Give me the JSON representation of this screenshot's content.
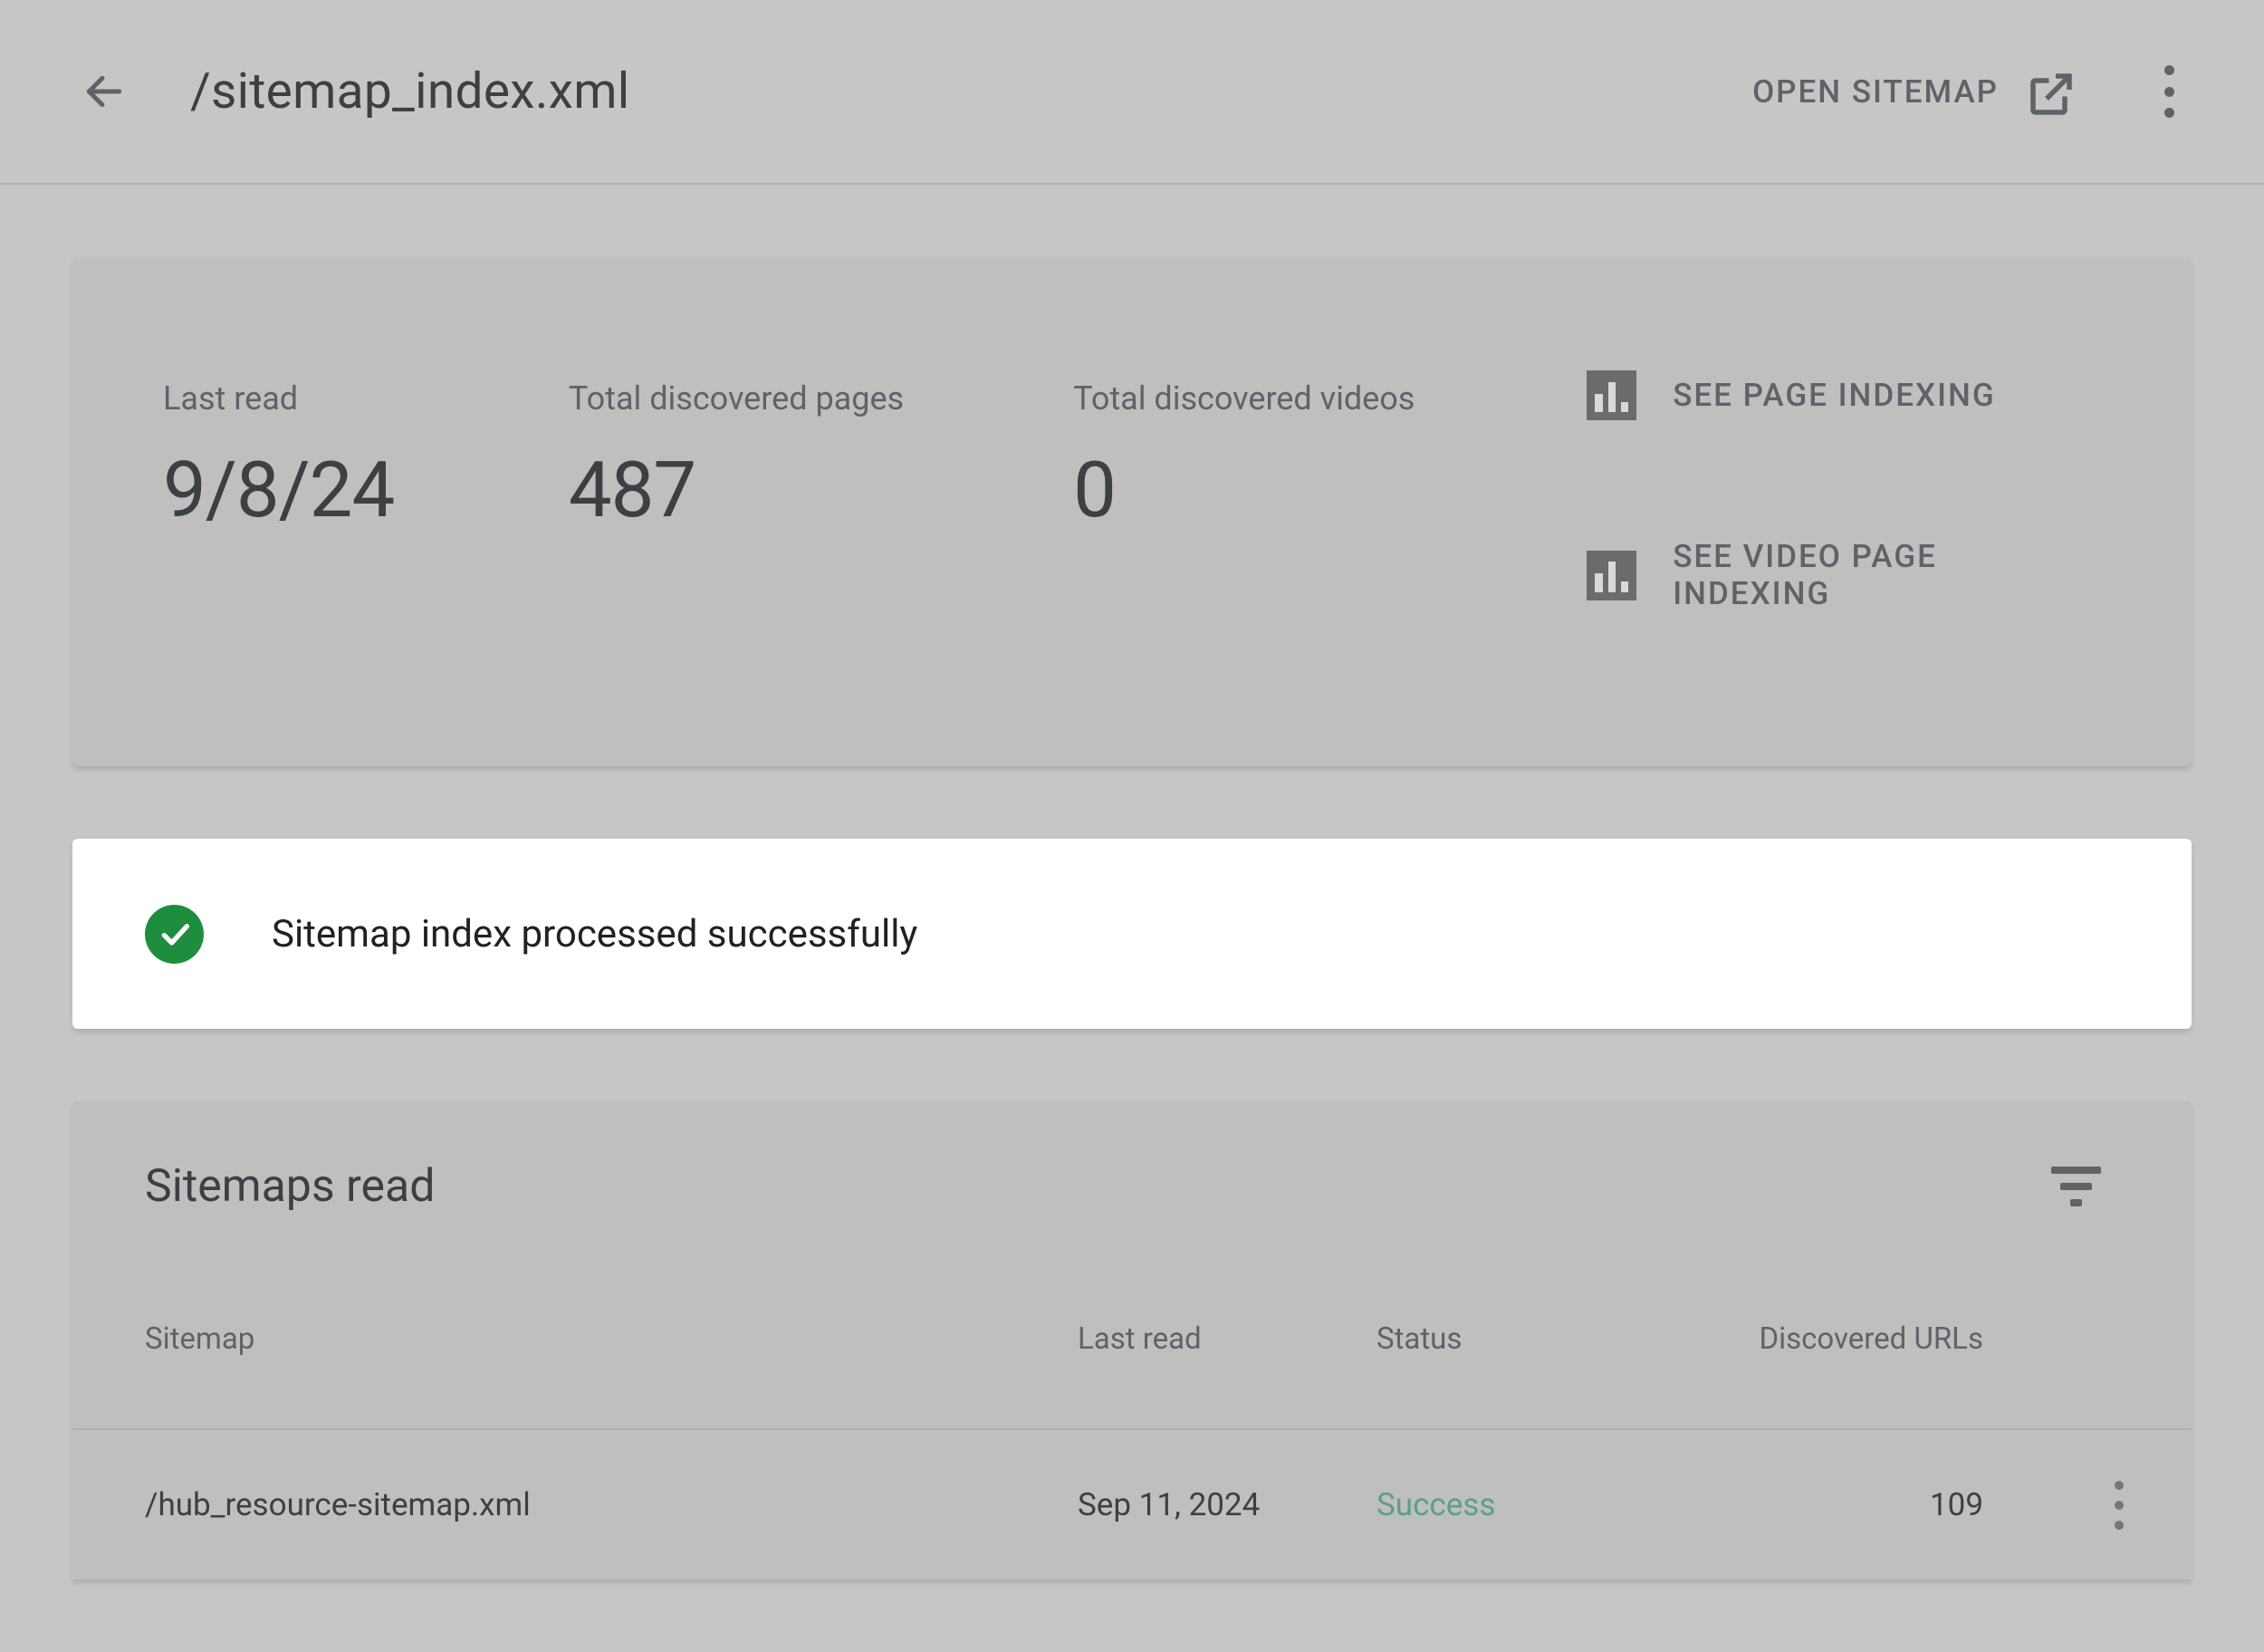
{
  "header": {
    "title": "/sitemap_index.xml",
    "open_label": "OPEN SITEMAP"
  },
  "stats": {
    "last_read_label": "Last read",
    "last_read_value": "9/8/24",
    "pages_label": "Total discovered pages",
    "pages_value": "487",
    "videos_label": "Total discovered videos",
    "videos_value": "0",
    "page_indexing_label": "SEE PAGE INDEXING",
    "video_indexing_label": "SEE VIDEO PAGE INDEXING"
  },
  "banner": {
    "message": "Sitemap index processed successfully"
  },
  "sitemaps": {
    "section_title": "Sitemaps read",
    "columns": {
      "sitemap": "Sitemap",
      "last_read": "Last read",
      "status": "Status",
      "discovered": "Discovered URLs"
    },
    "rows": [
      {
        "sitemap": "/hub_resource-sitemap.xml",
        "last_read": "Sep 11, 2024",
        "status": "Success",
        "discovered": "109"
      }
    ]
  }
}
